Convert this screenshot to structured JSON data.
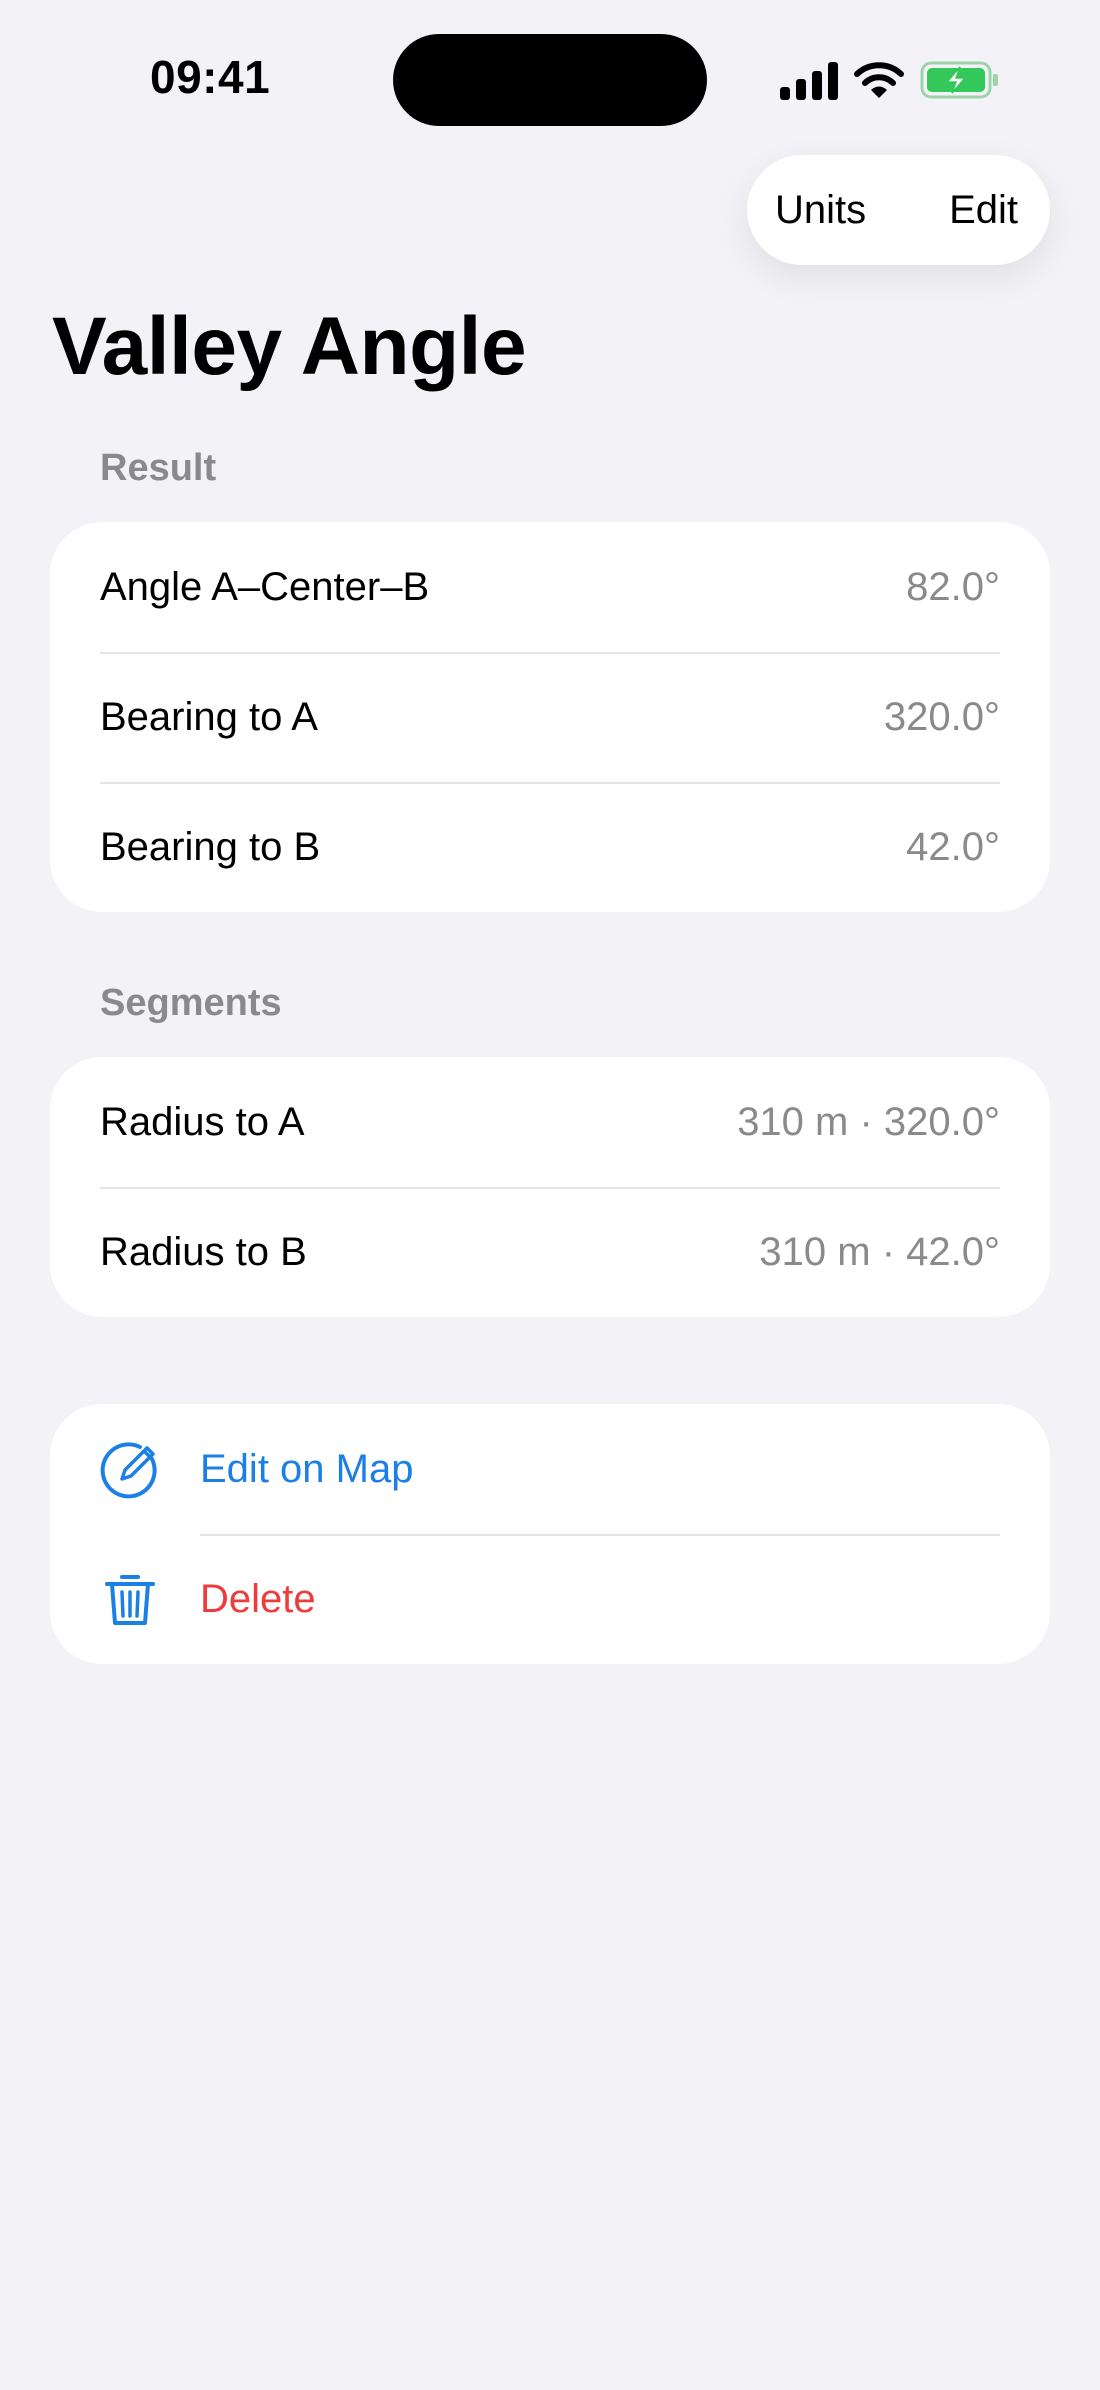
{
  "status_bar": {
    "time": "09:41",
    "icons": [
      "cellular-signal-icon",
      "wifi-icon",
      "battery-charging-icon"
    ]
  },
  "nav": {
    "units_label": "Units",
    "edit_label": "Edit"
  },
  "title": "Valley Angle",
  "result": {
    "header": "Result",
    "rows": [
      {
        "label": "Angle A–Center–B",
        "value": "82.0°"
      },
      {
        "label": "Bearing to A",
        "value": "320.0°"
      },
      {
        "label": "Bearing to B",
        "value": "42.0°"
      }
    ]
  },
  "segments": {
    "header": "Segments",
    "rows": [
      {
        "label": "Radius to A",
        "value": "310 m · 320.0°"
      },
      {
        "label": "Radius to B",
        "value": "310 m · 42.0°"
      }
    ]
  },
  "actions": {
    "edit_on_map": {
      "label": "Edit on Map",
      "icon": "pencil-circle-icon"
    },
    "delete": {
      "label": "Delete",
      "icon": "trash-icon"
    }
  },
  "colors": {
    "background": "#F2F2F7",
    "card": "#FFFFFF",
    "secondary_text": "#8A8A8E",
    "accent_blue": "#1C7FE6",
    "destructive_red": "#EE3B3B",
    "battery_green": "#34C759"
  }
}
